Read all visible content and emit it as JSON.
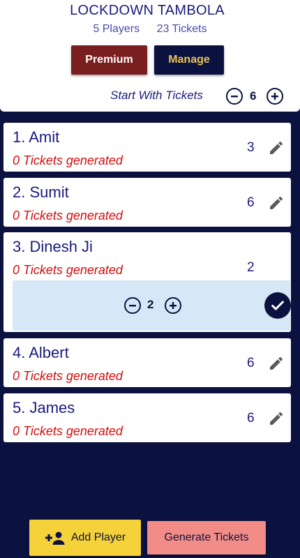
{
  "header": {
    "title": "LOCKDOWN TAMBOLA",
    "players_label": "5 Players",
    "tickets_label": "23 Tickets",
    "premium_label": "Premium",
    "manage_label": "Manage",
    "start_label": "Start With Tickets",
    "start_value": "6"
  },
  "players": [
    {
      "name": "1. Amit",
      "status": "0 Tickets generated",
      "count": "3"
    },
    {
      "name": "2. Sumit",
      "status": "0 Tickets generated",
      "count": "6"
    },
    {
      "name": "3. Dinesh Ji",
      "status": "0 Tickets generated",
      "count": "2",
      "editor_value": "2"
    },
    {
      "name": "4. Albert",
      "status": "0 Tickets generated",
      "count": "6"
    },
    {
      "name": "5. James",
      "status": "0 Tickets generated",
      "count": "6"
    }
  ],
  "footer": {
    "add_label": "Add Player",
    "generate_label": "Generate Tickets"
  },
  "colors": {
    "background": "#0b1240",
    "premium": "#7a1f1f",
    "manage_text": "#e8c35a",
    "status_red": "#d40d0d",
    "add_button": "#f6d23a",
    "generate_button": "#f28c86",
    "editor_panel": "#d6e8f7"
  },
  "icons": [
    "minus-circle-icon",
    "plus-circle-icon",
    "pencil-icon",
    "check-icon",
    "person-add-icon"
  ]
}
